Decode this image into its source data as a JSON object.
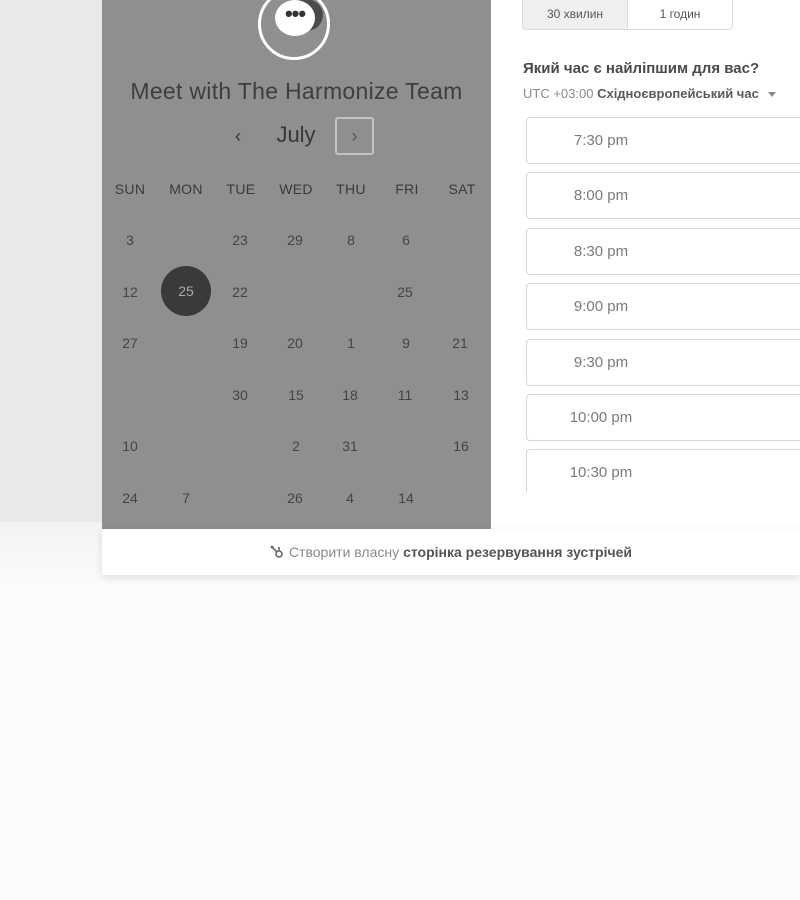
{
  "scheduler": {
    "title": "Meet with The Harmonize Team",
    "logo_icon": "chat-bubble-icon",
    "month": "July",
    "prev_icon": "‹",
    "next_icon": "›",
    "weekdays": [
      "SUN",
      "MON",
      "TUE",
      "WED",
      "THU",
      "FRI",
      "SAT"
    ],
    "days": {
      "r1": [
        "3",
        "23",
        "29",
        "8",
        "6"
      ],
      "r2": [
        "12",
        "25",
        "22",
        "25"
      ],
      "r3": [
        "27",
        "19",
        "20",
        "1",
        "9",
        "21"
      ],
      "r4": [
        "30",
        "15",
        "18",
        "11",
        "13"
      ],
      "r5": [
        "10",
        "2",
        "31",
        "16"
      ],
      "r6": [
        "24",
        "7",
        "26",
        "4",
        "14"
      ]
    },
    "selected_day": "25"
  },
  "durations": [
    "30 хвилин",
    "1 годин"
  ],
  "time_panel": {
    "question": "Який час є найліпшим для вас?",
    "tz_offset": "UTC +03:00",
    "tz_name": "Східноєвропейський час",
    "slots": [
      "7:30 pm",
      "8:00 pm",
      "8:30 pm",
      "9:00 pm",
      "9:30 pm",
      "10:00 pm",
      "10:30 pm"
    ]
  },
  "footer": {
    "prefix": "Створити власну",
    "link": "сторінка резервування зустрічей",
    "icon": "hubspot-icon"
  }
}
